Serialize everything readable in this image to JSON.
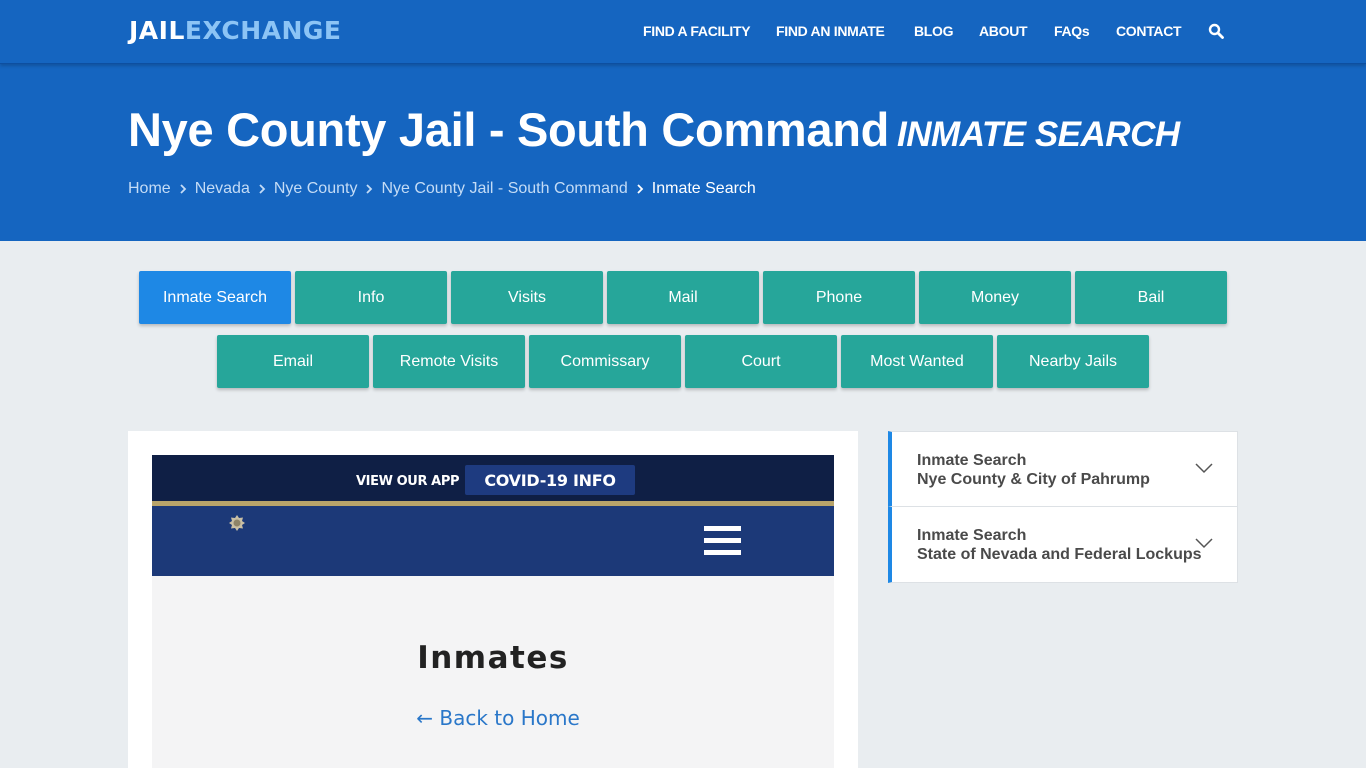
{
  "header": {
    "logo": {
      "part1": "JAIL",
      "part2": "EXCHANGE"
    },
    "nav": [
      {
        "label": "FIND A FACILITY"
      },
      {
        "label": "FIND AN INMATE"
      },
      {
        "label": "BLOG"
      },
      {
        "label": "ABOUT"
      },
      {
        "label": "FAQs"
      },
      {
        "label": "CONTACT"
      }
    ],
    "search_icon": "search-icon"
  },
  "hero": {
    "title": "Nye County Jail - South Command",
    "subtitle": "INMATE SEARCH",
    "breadcrumb": [
      {
        "label": "Home"
      },
      {
        "label": "Nevada"
      },
      {
        "label": "Nye County"
      },
      {
        "label": "Nye County Jail - South Command"
      },
      {
        "label": "Inmate Search"
      }
    ]
  },
  "tabs": {
    "row1": [
      {
        "label": "Inmate Search",
        "active": true
      },
      {
        "label": "Info"
      },
      {
        "label": "Visits"
      },
      {
        "label": "Mail"
      },
      {
        "label": "Phone"
      },
      {
        "label": "Money"
      },
      {
        "label": "Bail"
      }
    ],
    "row2": [
      {
        "label": "Email"
      },
      {
        "label": "Remote Visits"
      },
      {
        "label": "Commissary"
      },
      {
        "label": "Court"
      },
      {
        "label": "Most Wanted"
      },
      {
        "label": "Nearby Jails"
      }
    ]
  },
  "embed": {
    "app_link": "VIEW OUR APP",
    "covid_button": "COVID-19 INFO",
    "heading": "Inmates",
    "back_link": "← Back to Home"
  },
  "sidebar": {
    "items": [
      {
        "line1": "Inmate Search",
        "line2": "Nye County & City of Pahrump"
      },
      {
        "line1": "Inmate Search",
        "line2": "State of Nevada and Federal Lockups"
      }
    ]
  },
  "colors": {
    "brand_blue": "#1565c0",
    "logo_accent": "#8cc4f5",
    "tab_teal": "#26a69a",
    "tab_active": "#1e88e5",
    "embed_navy": "#0f1f45",
    "embed_nav_blue": "#1c3978",
    "embed_gold": "#b8a46a"
  }
}
